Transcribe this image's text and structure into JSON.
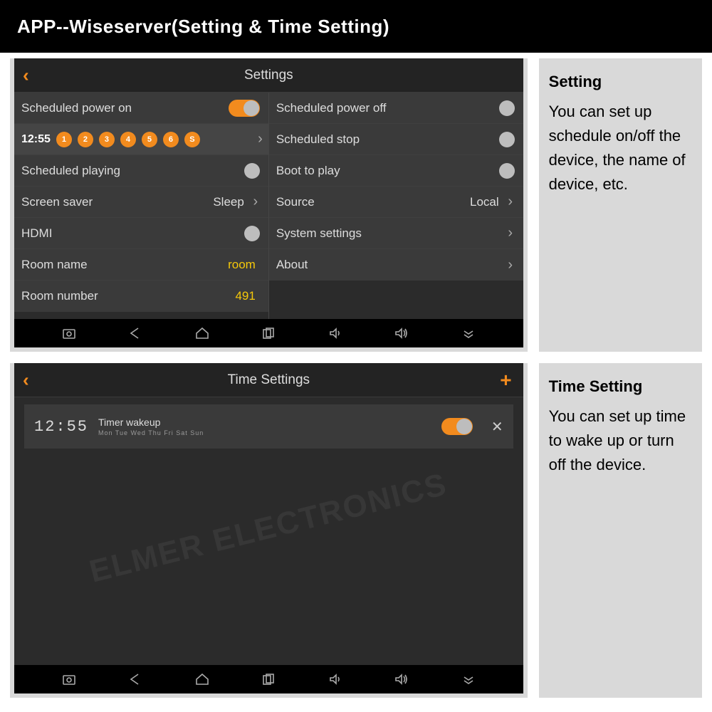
{
  "page_title": "APP--Wiseserver(Setting & Time Setting)",
  "settings": {
    "header": "Settings",
    "left": {
      "power_on": {
        "label": "Scheduled power on",
        "toggle": true
      },
      "time_value": "12:55",
      "day_badges": [
        "1",
        "2",
        "3",
        "4",
        "5",
        "6",
        "S"
      ],
      "playing": {
        "label": "Scheduled playing"
      },
      "screen_saver": {
        "label": "Screen saver",
        "value": "Sleep"
      },
      "hdmi": {
        "label": "HDMI"
      },
      "room_name": {
        "label": "Room name",
        "value": "room"
      },
      "room_number": {
        "label": "Room number",
        "value": "491"
      }
    },
    "right": {
      "power_off": {
        "label": "Scheduled power off"
      },
      "stop": {
        "label": "Scheduled stop"
      },
      "boot": {
        "label": "Boot to play"
      },
      "source": {
        "label": "Source",
        "value": "Local"
      },
      "system": {
        "label": "System settings"
      },
      "about": {
        "label": "About"
      }
    }
  },
  "time_settings": {
    "header": "Time Settings",
    "timer": {
      "clock": "12:55",
      "title": "Timer wakeup",
      "days": "Mon  Tue  Wed  Thu  Fri  Sat  Sun",
      "toggle": true
    }
  },
  "info_top": {
    "title": "Setting",
    "body": "You can set up schedule on/off the device, the name of device, etc."
  },
  "info_bot": {
    "title": "Time Setting",
    "body": "You can set up time to wake up or turn off the device."
  },
  "watermark": "ELMER ELECTRONICS"
}
